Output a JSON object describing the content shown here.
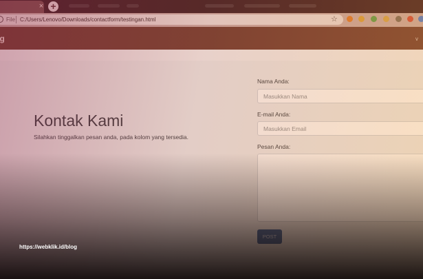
{
  "browser": {
    "file_label": "File",
    "url": "C:/Users/Lenovo/Downloads/contactform/testingan.html",
    "new_tab_symbol": "+",
    "close_symbol": "×",
    "star_symbol": "☆",
    "extensions": [
      {
        "name": "extension-orange-icon",
        "color": "#e07a2a"
      },
      {
        "name": "extension-yellow-icon",
        "color": "#d9a23a"
      },
      {
        "name": "extension-green-icon",
        "color": "#5aa04a"
      },
      {
        "name": "extension-face-icon",
        "color": "#d6a64a"
      },
      {
        "name": "extension-hex-icon",
        "color": "#7a6a5a"
      },
      {
        "name": "extension-red-icon",
        "color": "#d04a3a"
      },
      {
        "name": "extension-google-icon",
        "color": "#4a7ad0"
      }
    ]
  },
  "navbar": {
    "brand": "og",
    "background": "#6e3b30",
    "caret": "v"
  },
  "hero": {
    "title": "Kontak Kami",
    "lead": "Silahkan tinggalkan pesan anda, pada kolom yang tersedia."
  },
  "form": {
    "name_label": "Nama Anda:",
    "name_placeholder": "Masukkan Nama",
    "email_label": "E-mail Anda:",
    "email_placeholder": "Masukkan Email",
    "message_label": "Pesan Anda:",
    "submit_label": "POST",
    "submit_color": "#2f5e99"
  },
  "watermark": "https://webklik.id/blog"
}
